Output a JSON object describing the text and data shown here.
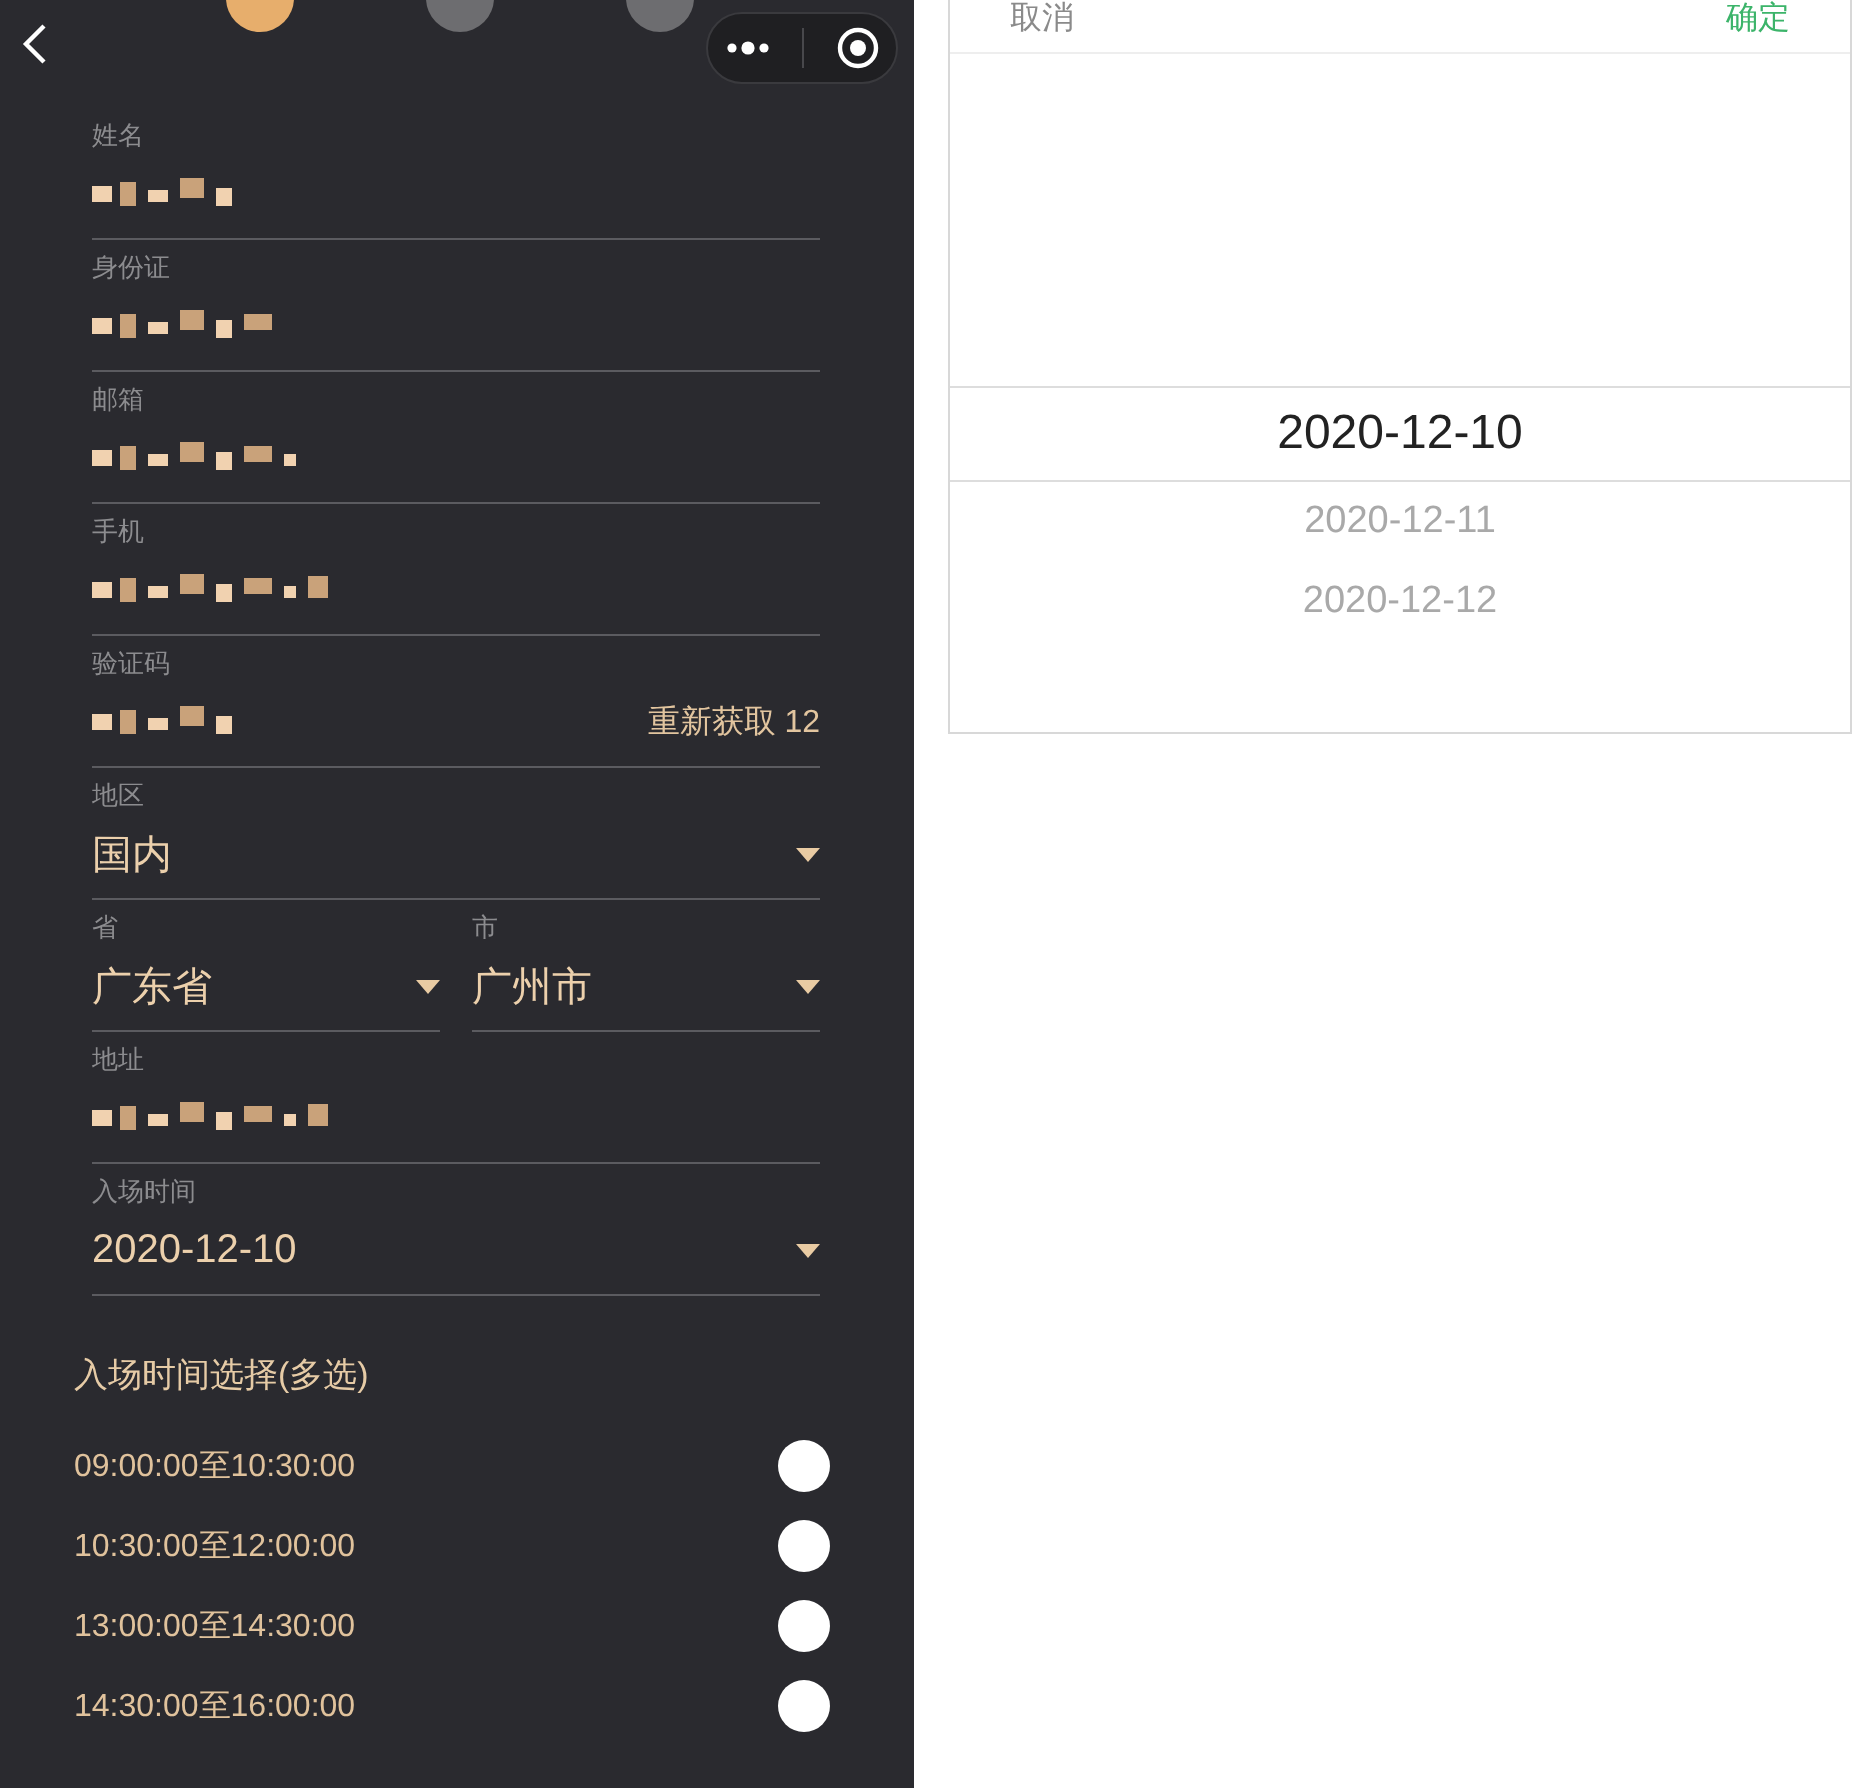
{
  "steps": [
    {
      "selected": true
    },
    {
      "selected": false
    },
    {
      "selected": false
    }
  ],
  "form": {
    "fields": [
      {
        "kind": "text",
        "label": "姓名",
        "redacted": true
      },
      {
        "kind": "text",
        "label": "身份证",
        "redacted": true
      },
      {
        "kind": "text",
        "label": "邮箱",
        "redacted": true
      },
      {
        "kind": "text",
        "label": "手机",
        "redacted": true
      },
      {
        "kind": "code",
        "label": "验证码",
        "redacted": true,
        "action": "重新获取 12"
      },
      {
        "kind": "select",
        "label": "地区",
        "value": "国内"
      },
      {
        "kind": "pair",
        "items": [
          {
            "label": "省",
            "value": "广东省"
          },
          {
            "label": "市",
            "value": "广州市"
          }
        ]
      },
      {
        "kind": "text",
        "label": "地址",
        "redacted": true
      },
      {
        "kind": "select",
        "label": "入场时间",
        "value": "2020-12-10"
      }
    ]
  },
  "slots": {
    "title": "入场时间选择(多选)",
    "items": [
      {
        "label": "09:00:00至10:30:00",
        "checked": false
      },
      {
        "label": "10:30:00至12:00:00",
        "checked": false
      },
      {
        "label": "13:00:00至14:30:00",
        "checked": false
      },
      {
        "label": "14:30:00至16:00:00",
        "checked": false
      }
    ]
  },
  "picker": {
    "cancel": "取消",
    "confirm": "确定",
    "options": [
      {
        "label": "2020-12-10",
        "selected": true
      },
      {
        "label": "2020-12-11",
        "selected": false
      },
      {
        "label": "2020-12-12",
        "selected": false
      }
    ]
  }
}
